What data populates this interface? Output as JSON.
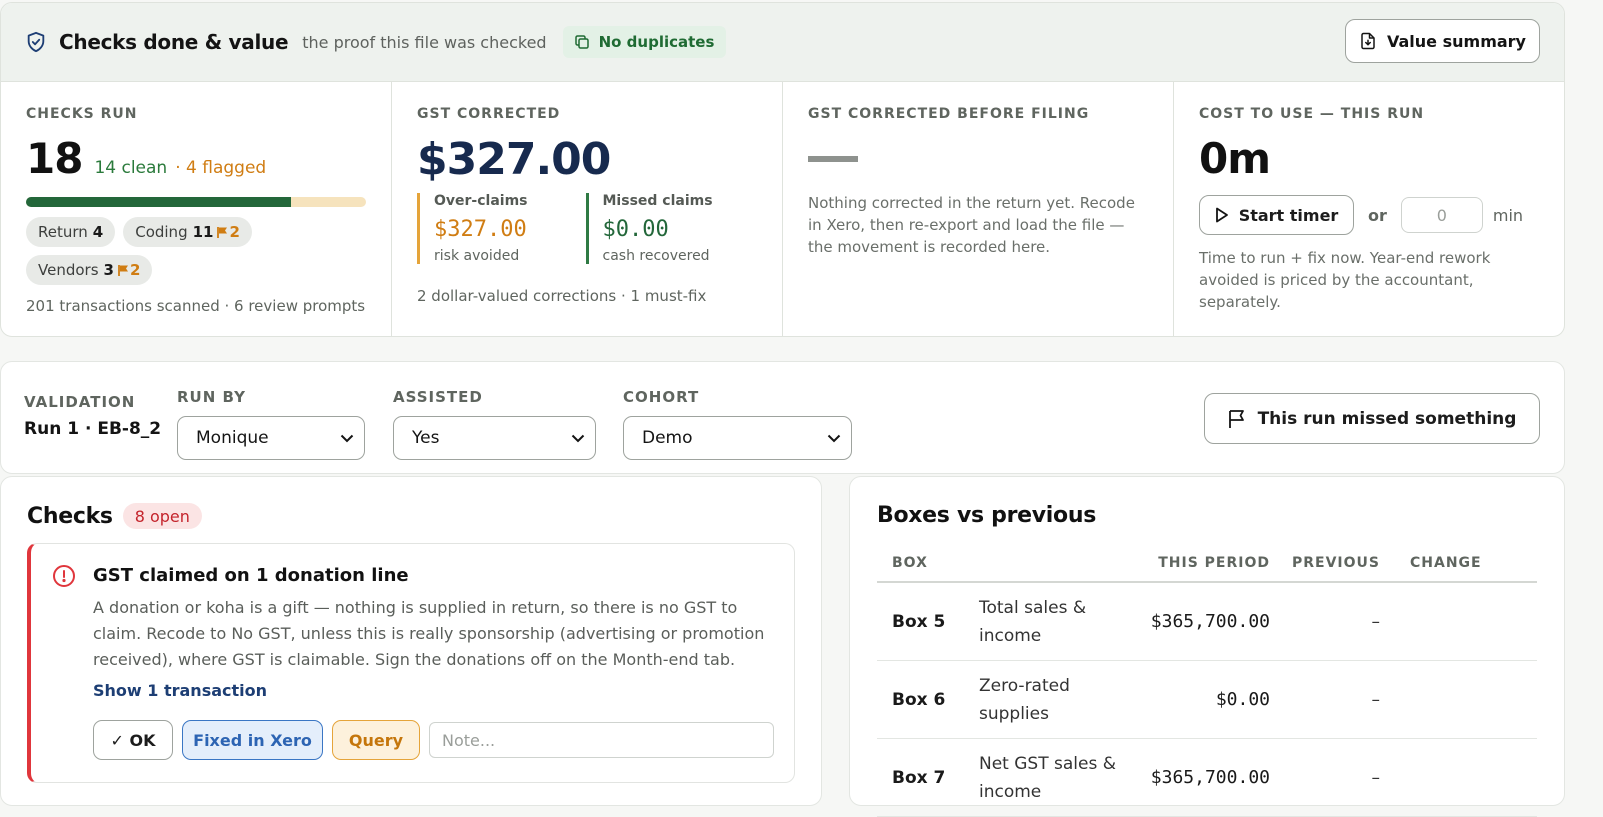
{
  "header": {
    "title": "Checks done & value",
    "subtitle": "the proof this file was checked",
    "dup_badge": "No duplicates",
    "value_summary_label": "Value summary"
  },
  "checks_run": {
    "label": "CHECKS RUN",
    "count": "18",
    "clean": "14 clean",
    "flagged": "· 4 flagged",
    "progress_fraction": 0.78,
    "pills": [
      {
        "name": "Return",
        "count": "4",
        "flags": ""
      },
      {
        "name": "Coding",
        "count": "11",
        "flags": "2"
      },
      {
        "name": "Vendors",
        "count": "3",
        "flags": "2"
      }
    ],
    "footer": "201 transactions scanned · 6 review prompts"
  },
  "gst_corrected": {
    "label": "GST CORRECTED",
    "amount": "$327.00",
    "over_claims": {
      "title": "Over-claims",
      "value": "$327.00",
      "desc": "risk avoided"
    },
    "missed_claims": {
      "title": "Missed claims",
      "value": "$0.00",
      "desc": "cash recovered"
    },
    "footer": "2 dollar-valued corrections · 1 must-fix"
  },
  "gst_before_filing": {
    "label": "GST CORRECTED BEFORE FILING",
    "note": "Nothing corrected in the return yet. Recode in Xero, then re-export and load the file — the movement is recorded here."
  },
  "cost": {
    "label": "COST TO USE — THIS RUN",
    "value": "0m",
    "start_timer": "Start timer",
    "or": "or",
    "minutes_placeholder": "0",
    "min_label": "min",
    "note": "Time to run + fix now. Year-end rework avoided is priced by the accountant, separately."
  },
  "validation": {
    "label": "VALIDATION",
    "run": "Run 1 · EB-8_2",
    "run_by": {
      "label": "RUN BY",
      "value": "Monique"
    },
    "assisted": {
      "label": "ASSISTED",
      "value": "Yes"
    },
    "cohort": {
      "label": "COHORT",
      "value": "Demo"
    },
    "missed_label": "This run missed something"
  },
  "checks": {
    "title": "Checks",
    "open_badge": "8 open",
    "alert": {
      "title": "GST claimed on 1 donation line",
      "body": "A donation or koha is a gift — nothing is supplied in return, so there is no GST to claim. Recode to No GST, unless this is really sponsorship (advertising or promotion received), where GST is claimable. Sign the donations off on the Month-end tab.",
      "show_link": "Show 1 transaction",
      "ok_label": "✓ OK",
      "fixed_label": "Fixed in Xero",
      "query_label": "Query",
      "note_placeholder": "Note..."
    }
  },
  "boxes": {
    "title": "Boxes vs previous",
    "headers": {
      "box": "BOX",
      "this_period": "THIS PERIOD",
      "previous": "PREVIOUS",
      "change": "CHANGE"
    },
    "rows": [
      {
        "box": "Box 5",
        "desc": "Total sales & income",
        "this_period": "$365,700.00",
        "previous": "–",
        "change": ""
      },
      {
        "box": "Box 6",
        "desc": "Zero-rated supplies",
        "this_period": "$0.00",
        "previous": "–",
        "change": ""
      },
      {
        "box": "Box 7",
        "desc": "Net GST sales & income",
        "this_period": "$365,700.00",
        "previous": "–",
        "change": ""
      }
    ]
  },
  "colors": {
    "accent_green": "#23673a",
    "flag_amber": "#d07d13",
    "alert_red": "#e0363c",
    "navy": "#172a4e"
  }
}
